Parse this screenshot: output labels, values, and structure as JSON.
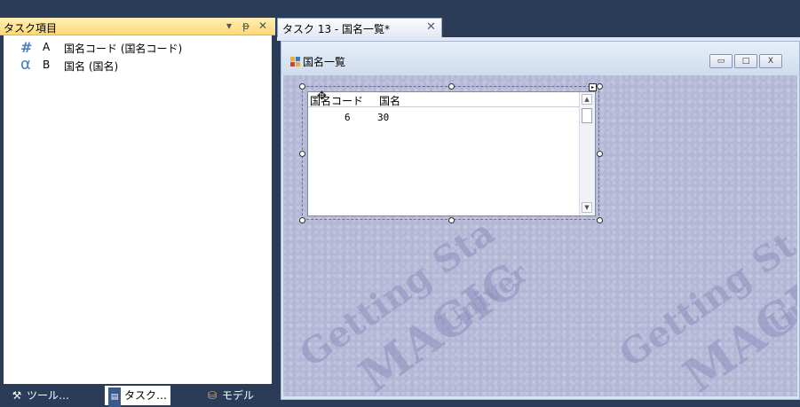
{
  "left_panel": {
    "title": "タスク項目",
    "dropdown_icon": "▾",
    "pin_icon": "ᵽ",
    "close_icon": "✕",
    "variables": [
      {
        "icon": "#",
        "letter": "A",
        "name": "国名コード (国名コード)"
      },
      {
        "icon": "α",
        "letter": "B",
        "name": "国名 (国名)"
      }
    ],
    "bottom_tabs": [
      {
        "icon": "tools-icon",
        "label": "ツール…"
      },
      {
        "icon": "task-icon",
        "label": "タスク…"
      },
      {
        "icon": "model-icon",
        "label": "モデル"
      }
    ]
  },
  "document": {
    "tab_title": "タスク 13 - 国名一覧*",
    "tab_close": "✕",
    "form": {
      "title": "国名一覧",
      "minimize": "▭",
      "maximize": "□",
      "close": "X"
    },
    "table": {
      "columns": [
        "国名コード",
        "国名"
      ],
      "rows": [
        {
          "code": "6",
          "name": "30"
        }
      ]
    },
    "watermark": [
      "Getting Sta",
      "MAGIC",
      "Univer",
      "Getting St",
      "MAGIC",
      "Un"
    ]
  },
  "colors": {
    "background": "#2b3c59",
    "panel_header": "#ffd976",
    "form_body": "#b4b6d6"
  }
}
